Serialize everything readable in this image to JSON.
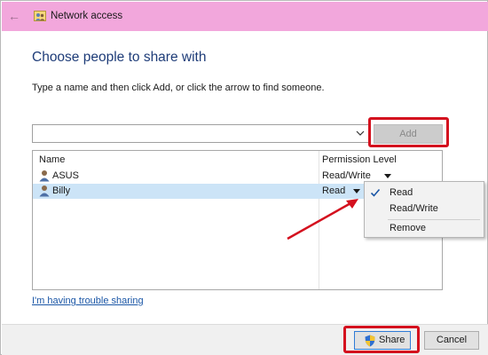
{
  "window": {
    "title": "Network access",
    "back_icon": "back-arrow-icon",
    "title_icon": "network-people-icon"
  },
  "main": {
    "heading": "Choose people to share with",
    "instruction": "Type a name and then click Add, or click the arrow to find someone.",
    "name_input": {
      "value": "",
      "placeholder": ""
    },
    "add_button": "Add",
    "list": {
      "headers": {
        "name": "Name",
        "permission": "Permission Level"
      },
      "rows": [
        {
          "name": "ASUS",
          "permission": "Read/Write",
          "selected": false
        },
        {
          "name": "Billy",
          "permission": "Read",
          "selected": true
        }
      ]
    },
    "permission_menu": {
      "items": [
        {
          "label": "Read",
          "checked": true
        },
        {
          "label": "Read/Write",
          "checked": false
        },
        {
          "label": "Remove",
          "checked": false
        }
      ]
    },
    "trouble_link": "I'm having trouble sharing"
  },
  "footer": {
    "share_button": "Share",
    "cancel_button": "Cancel"
  },
  "colors": {
    "titlebar": "#f2a7dc",
    "heading": "#1e3c78",
    "highlight": "#d4101e",
    "selected_row": "#cce4f7",
    "link": "#1a56a6"
  }
}
